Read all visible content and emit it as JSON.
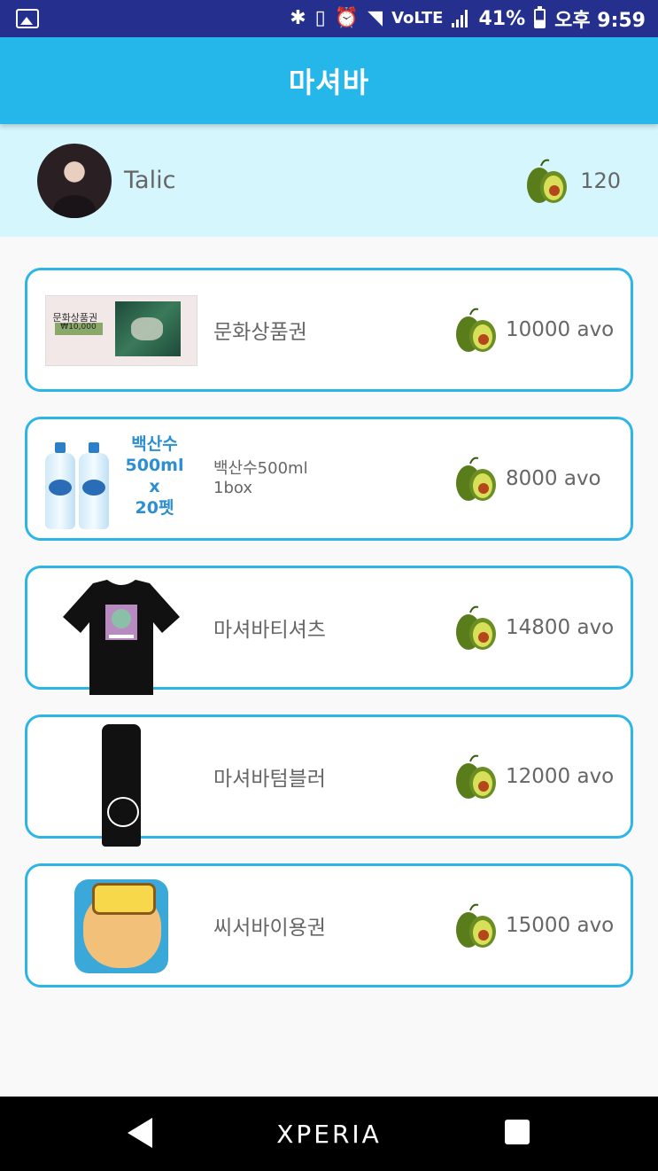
{
  "status_bar": {
    "battery_percent": "41%",
    "network": "VoLTE",
    "clock": "오후 9:59",
    "battery_level": 0.41,
    "icons": [
      "gallery-icon",
      "bluetooth-icon",
      "vibrate-icon",
      "alarm-icon",
      "wifi-icon",
      "volte-icon",
      "signal-icon",
      "battery-icon"
    ]
  },
  "header": {
    "title": "마셔바"
  },
  "profile": {
    "name": "Talic",
    "points": "120"
  },
  "items": [
    {
      "name": "문화상품권",
      "price": "10000 avo",
      "thumb": "gift-certificate"
    },
    {
      "name": "백산수500ml\n1box",
      "price": "8000 avo",
      "thumb": "water-bottles",
      "thumb_text": "백산수\n500ml\nx\n20펫"
    },
    {
      "name": "마셔바티셔츠",
      "price": "14800 avo",
      "thumb": "tshirt"
    },
    {
      "name": "마셔바텀블러",
      "price": "12000 avo",
      "thumb": "tumbler"
    },
    {
      "name": "씨서바이용권",
      "price": "15000 avo",
      "thumb": "character-icon"
    }
  ],
  "gift_certificate": {
    "label": "문화상품권",
    "amount": "₩10,000"
  },
  "nav_bar": {
    "brand": "XPERIA"
  },
  "colors": {
    "status_bar": "#25308e",
    "app_bar": "#26b7ea",
    "profile_bg": "#d4f6fc",
    "card_border": "#2eb5e8",
    "avocado_skin": "#6b8e23",
    "avocado_flesh": "#d8e05a",
    "avocado_pit": "#b5451b"
  }
}
